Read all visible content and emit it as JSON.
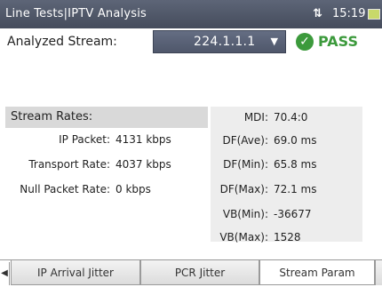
{
  "titlebar": {
    "title": "Line Tests|IPTV Analysis",
    "time": "15:19",
    "network_icon": "network-activity-icon",
    "battery_icon": "battery-icon"
  },
  "stream": {
    "label": "Analyzed Stream:",
    "selected": "224.1.1.1",
    "status": "PASS",
    "status_icon": "checkmark-icon",
    "status_color": "#3c9a3c"
  },
  "rates": {
    "header": "Stream Rates:",
    "rows": [
      {
        "label": "IP Packet:",
        "value": "4131 kbps"
      },
      {
        "label": "Transport Rate:",
        "value": "4037 kbps"
      },
      {
        "label": "Null Packet Rate:",
        "value": "0 kbps"
      }
    ]
  },
  "metrics": [
    {
      "label": "MDI:",
      "value": "70.4:0"
    },
    {
      "label": "DF(Ave):",
      "value": "69.0 ms"
    },
    {
      "label": "DF(Min):",
      "value": "65.8 ms"
    },
    {
      "label": "DF(Max):",
      "value": "72.1 ms"
    },
    {
      "label": "VB(Min):",
      "value": "-36677"
    },
    {
      "label": "VB(Max):",
      "value": "1528"
    }
  ],
  "tabs": [
    {
      "label": "IP Arrival Jitter"
    },
    {
      "label": "PCR Jitter"
    },
    {
      "label": "Stream Param"
    }
  ]
}
